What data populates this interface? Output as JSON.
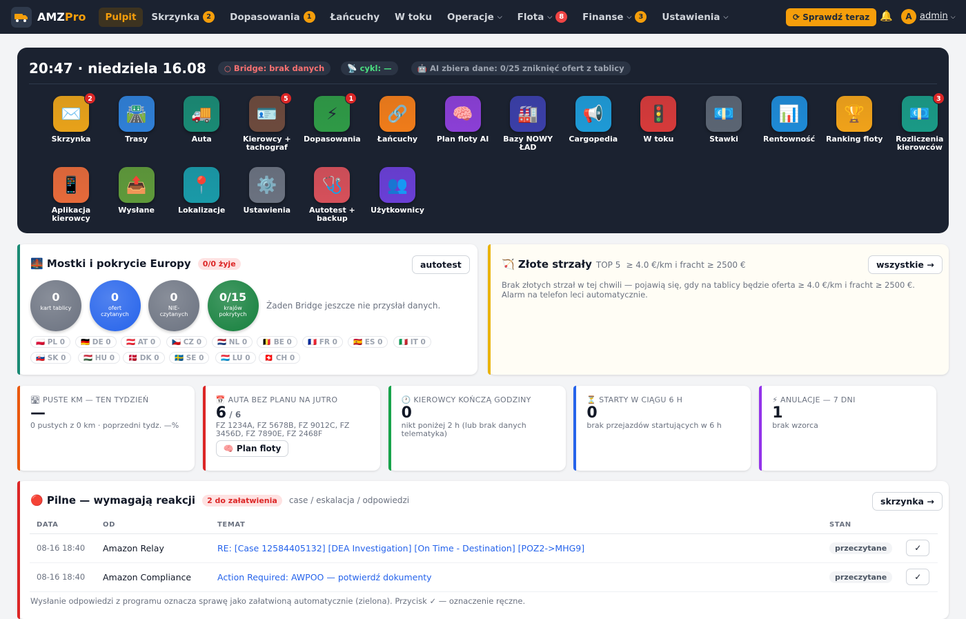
{
  "nav": {
    "brand_main": "AMZ",
    "brand_accent": "Pro",
    "items": [
      {
        "label": "Pulpit",
        "badge": "",
        "chevron": false,
        "active": true
      },
      {
        "label": "Skrzynka",
        "badge": "2",
        "badge_color": "yellow",
        "chevron": false
      },
      {
        "label": "Dopasowania",
        "badge": "1",
        "badge_color": "yellow",
        "chevron": false
      },
      {
        "label": "Łańcuchy",
        "badge": "",
        "chevron": false
      },
      {
        "label": "W toku",
        "badge": "",
        "chevron": false
      },
      {
        "label": "Operacje",
        "badge": "",
        "chevron": true
      },
      {
        "label": "Flota",
        "badge": "8",
        "badge_color": "red",
        "chevron": true
      },
      {
        "label": "Finanse",
        "badge": "3",
        "badge_color": "yellow",
        "chevron": true
      },
      {
        "label": "Ustawienia",
        "badge": "",
        "chevron": true
      }
    ],
    "check_button": "⟳ Sprawdź teraz",
    "avatar_letter": "A",
    "user": "admin"
  },
  "dashboard": {
    "clock": "20:47 · niedziela 16.08",
    "bridge_chip": "○ Bridge: brak danych",
    "cykl_chip": "📡 cykl: —",
    "ai_chip": "🤖 AI zbiera dane: 0/25 zniknięć ofert z tablicy",
    "tiles": [
      {
        "label": "Skrzynka",
        "icon": "✉️",
        "badge": "2",
        "bg": "#e8a21a",
        "icon_name": "envelope-icon"
      },
      {
        "label": "Trasy",
        "icon": "🛣️",
        "badge": "",
        "bg": "#2f7fd6",
        "icon_name": "road-icon"
      },
      {
        "label": "Auta",
        "icon": "🚚",
        "badge": "",
        "bg": "#1a8a74",
        "icon_name": "truck-icon"
      },
      {
        "label": "Kierowcy + tachograf",
        "icon": "🪪",
        "badge": "5",
        "bg": "#6d4a3d",
        "icon_name": "id-card-icon"
      },
      {
        "label": "Dopasowania",
        "icon": "⚡",
        "badge": "1",
        "bg": "#2f9a46",
        "icon_name": "lightning-icon"
      },
      {
        "label": "Łańcuchy",
        "icon": "🔗",
        "badge": "",
        "bg": "#f07c1a",
        "icon_name": "link-icon"
      },
      {
        "label": "Plan floty AI",
        "icon": "🧠",
        "badge": "",
        "bg": "#8b3fd6",
        "icon_name": "brain-icon"
      },
      {
        "label": "Bazy NOWY ŁAD",
        "icon": "🏭",
        "badge": "",
        "bg": "#3b3fa8",
        "icon_name": "factory-icon"
      },
      {
        "label": "Cargopedia",
        "icon": "📢",
        "badge": "",
        "bg": "#1e9ad6",
        "icon_name": "megaphone-icon"
      },
      {
        "label": "W toku",
        "icon": "🚦",
        "badge": "",
        "bg": "#d63a3a",
        "icon_name": "traffic-light-icon"
      },
      {
        "label": "Stawki",
        "icon": "💶",
        "badge": "",
        "bg": "#5b6573",
        "icon_name": "money-icon"
      },
      {
        "label": "Rentowność",
        "icon": "📊",
        "badge": "",
        "bg": "#1e8ad6",
        "icon_name": "chart-icon"
      },
      {
        "label": "Ranking floty",
        "icon": "🏆",
        "badge": "",
        "bg": "#f0a21a",
        "icon_name": "trophy-icon"
      },
      {
        "label": "Rozliczenia kierowców",
        "icon": "💶",
        "badge": "3",
        "bg": "#1a9a86",
        "icon_name": "payment-icon"
      },
      {
        "label": "Aplikacja kierowcy",
        "icon": "📱",
        "badge": "",
        "bg": "#e66a3a",
        "icon_name": "phone-icon"
      },
      {
        "label": "Wysłane",
        "icon": "📤",
        "badge": "",
        "bg": "#5f9a3a",
        "icon_name": "outbox-icon"
      },
      {
        "label": "Lokalizacje",
        "icon": "📍",
        "badge": "",
        "bg": "#1a9aa8",
        "icon_name": "pin-icon"
      },
      {
        "label": "Ustawienia",
        "icon": "⚙️",
        "badge": "",
        "bg": "#6b7280",
        "icon_name": "gear-icon"
      },
      {
        "label": "Autotest + backup",
        "icon": "🩺",
        "badge": "",
        "bg": "#d6505a",
        "icon_name": "stethoscope-icon"
      },
      {
        "label": "Użytkownicy",
        "icon": "👥",
        "badge": "",
        "bg": "#6a3fd6",
        "icon_name": "users-icon"
      }
    ]
  },
  "bridges": {
    "title": "🌉 Mostki i pokrycie Europy",
    "status_pill": "0/0 żyje",
    "autotest_button": "autotest",
    "circles": [
      {
        "num": "0",
        "label": "kart tablicy",
        "color": "#6b7280"
      },
      {
        "num": "0",
        "label": "ofert czytanych",
        "color": "#2563eb"
      },
      {
        "num": "0",
        "label": "NIE-czytanych",
        "color": "#6b7280"
      },
      {
        "num": "0/15",
        "label": "krajów pokrytych",
        "color": "#15803d"
      }
    ],
    "no_data": "Żaden Bridge jeszcze nie przysłał danych.",
    "flags": [
      "🇵🇱 PL 0",
      "🇩🇪 DE 0",
      "🇦🇹 AT 0",
      "🇨🇿 CZ 0",
      "🇳🇱 NL 0",
      "🇧🇪 BE 0",
      "🇫🇷 FR 0",
      "🇪🇸 ES 0",
      "🇮🇹 IT 0",
      "🇸🇰 SK 0",
      "🇭🇺 HU 0",
      "🇩🇰 DK 0",
      "🇸🇪 SE 0",
      "🇱🇺 LU 0",
      "🇨🇭 CH 0"
    ]
  },
  "golden": {
    "title": "🏹 Złote strzały",
    "top": "TOP 5",
    "criteria": "≥ 4.0 €/km i fracht ≥ 2500 €",
    "all_button": "wszystkie →",
    "text": "Brak złotych strzał w tej chwili — pojawią się, gdy na tablicy będzie oferta ≥ 4.0 €/km i fracht ≥ 2500 €. Alarm na telefon leci automatycznie."
  },
  "kpis": [
    {
      "title": "🛣 PUSTE KM — TEN TYDZIEŃ",
      "value": "—",
      "suffix": "",
      "sub": "0 pustych z 0 km · poprzedni tydz. —%",
      "color": "#ea580c"
    },
    {
      "title": "📅 AUTA BEZ PLANU NA JUTRO",
      "value": "6",
      "suffix": " / 6",
      "sub": "FZ 1234A, FZ 5678B, FZ 9012C, FZ 3456D, FZ 7890E, FZ 2468F",
      "color": "#dc2626",
      "button": "🧠 Plan floty"
    },
    {
      "title": "🕐 KIEROWCY KOŃCZĄ GODZINY",
      "value": "0",
      "suffix": "",
      "sub": "nikt poniżej 2 h (lub brak danych telematyka)",
      "color": "#16a34a"
    },
    {
      "title": "⏳ STARTY W CIĄGU 6 H",
      "value": "0",
      "suffix": "",
      "sub": "brak przejazdów startujących w 6 h",
      "color": "#2563eb"
    },
    {
      "title": "⚡ ANULACJE — 7 DNI",
      "value": "1",
      "suffix": "",
      "sub": "brak wzorca",
      "color": "#9333ea"
    }
  ],
  "urgent": {
    "title": "🔴 Pilne — wymagają reakcji",
    "pill": "2 do załatwienia",
    "subtitle": "case / eskalacja / odpowiedzi",
    "inbox_button": "skrzynka →",
    "headers": [
      "DATA",
      "OD",
      "TEMAT",
      "STAN",
      ""
    ],
    "rows": [
      {
        "date": "08-16 18:40",
        "from": "Amazon Relay",
        "subject": "RE: [Case 12584405132] [DEA Investigation] [On Time - Destination] [POZ2->MHG9]",
        "state": "przeczytane"
      },
      {
        "date": "08-16 18:40",
        "from": "Amazon Compliance",
        "subject": "Action Required: AWPOO — potwierdź dokumenty",
        "state": "przeczytane"
      }
    ],
    "footnote": "Wysłanie odpowiedzi z programu oznacza sprawę jako załatwioną automatycznie (zielona). Przycisk ✓ — oznaczenie ręczne."
  }
}
